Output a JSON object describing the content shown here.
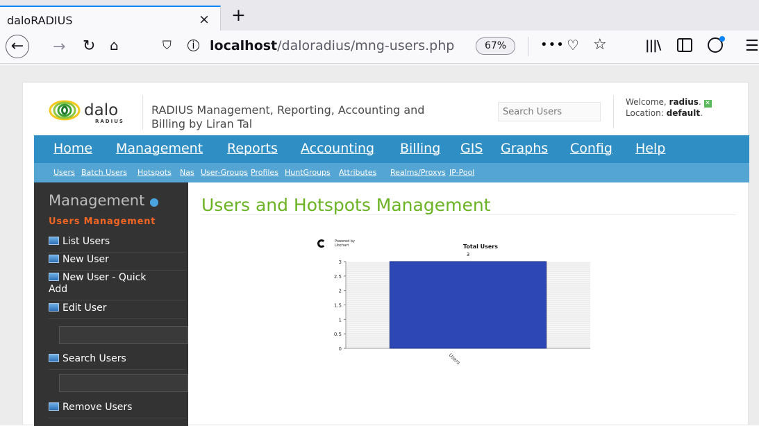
{
  "browser": {
    "tab_title": "daloRADIUS",
    "tab_close": "×",
    "new_tab": "+",
    "url_host": "localhost",
    "url_path": "/daloradius/mng-users.php",
    "zoom": "67%",
    "more": "•••"
  },
  "header": {
    "logo_text": "dalo",
    "logo_subtext": "RADIUS",
    "tagline_line1": "RADIUS Management, Reporting, Accounting and",
    "tagline_line2": "Billing by Liran Tal",
    "search_placeholder": "Search Users",
    "welcome_prefix": "Welcome, ",
    "welcome_user": "radius",
    "location_prefix": "Location: ",
    "location_value": "default"
  },
  "main_nav": {
    "items": [
      "Home",
      "Management",
      "Reports",
      "Accounting",
      "Billing",
      "GIS",
      "Graphs",
      "Config",
      "Help"
    ],
    "active": "Management"
  },
  "sub_nav": {
    "items": [
      "Users",
      "Batch Users",
      "Hotspots",
      "Nas",
      "User-Groups",
      "Profiles",
      "HuntGroups",
      "Attributes",
      "Realms/Proxys",
      "IP-Pool"
    ]
  },
  "sidebar": {
    "title": "Management",
    "subtitle": "Users Management",
    "items": {
      "list_users": "List Users",
      "new_user": "New User",
      "new_user_quick_line1": "New User - Quick",
      "new_user_quick_line2": "Add",
      "edit_user": "Edit User",
      "search_users": "Search Users",
      "remove_users": "Remove Users"
    }
  },
  "content": {
    "title": "Users and Hotspots Management"
  },
  "chart_badge": {
    "line1": "Powered by",
    "line2": "Libchart"
  },
  "chart_data": {
    "type": "bar",
    "title": "Total Users",
    "categories": [
      "Users"
    ],
    "values": [
      3
    ],
    "data_labels": [
      "3"
    ],
    "yticks": [
      "0",
      "0.5",
      "1",
      "1.5",
      "2",
      "2.5",
      "3"
    ],
    "ylim": [
      0,
      3
    ],
    "bar_color": "#2d47b5",
    "xlabel": "",
    "ylabel": ""
  }
}
